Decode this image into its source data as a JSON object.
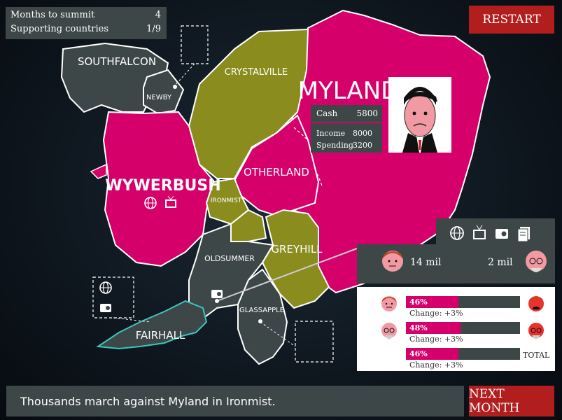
{
  "stats": {
    "months_label": "Months to summit",
    "months_value": "4",
    "support_label": "Supporting countries",
    "support_value": "1/9"
  },
  "restart_label": "RESTART",
  "next_label": "NEXT MONTH",
  "news": "Thousands march against Myland in Ironmist.",
  "myland": {
    "title": "MYLAND",
    "cash_label": "Cash",
    "cash_value": "5800",
    "income_label": "Income",
    "income_value": "8000",
    "spending_label": "Spending",
    "spending_value": "3200"
  },
  "regions": {
    "southfalcon": "SOUTHFALCON",
    "newby": "NEWBY",
    "crystalville": "CRYSTALVILLE",
    "wywerbush": "WYWERBUSH",
    "otherland": "OTHERLAND",
    "ironmist": "IRONMIST",
    "greyhill": "GREYHILL",
    "oldsummer": "OLDSUMMER",
    "glassapple": "GLASSAPPLE",
    "fairhall": "FAIRHALL"
  },
  "population": {
    "young": "14 mil",
    "old": "2 mil"
  },
  "support": {
    "young_pct": "46%",
    "young_change": "Change: +3%",
    "old_pct": "48%",
    "old_change": "Change: +3%",
    "total_pct": "46%",
    "total_change": "Change: +3%",
    "total_label": "TOTAL",
    "young_level": 0.46,
    "old_level": 0.48,
    "total_level": 0.46
  },
  "colors": {
    "myland_pink": "#d6006b",
    "olive": "#8a8c1e",
    "slate": "#3d4747",
    "red_button": "#b21d1d"
  },
  "icons": [
    "globe-icon",
    "tv-icon",
    "radio-icon",
    "newspaper-icon"
  ]
}
